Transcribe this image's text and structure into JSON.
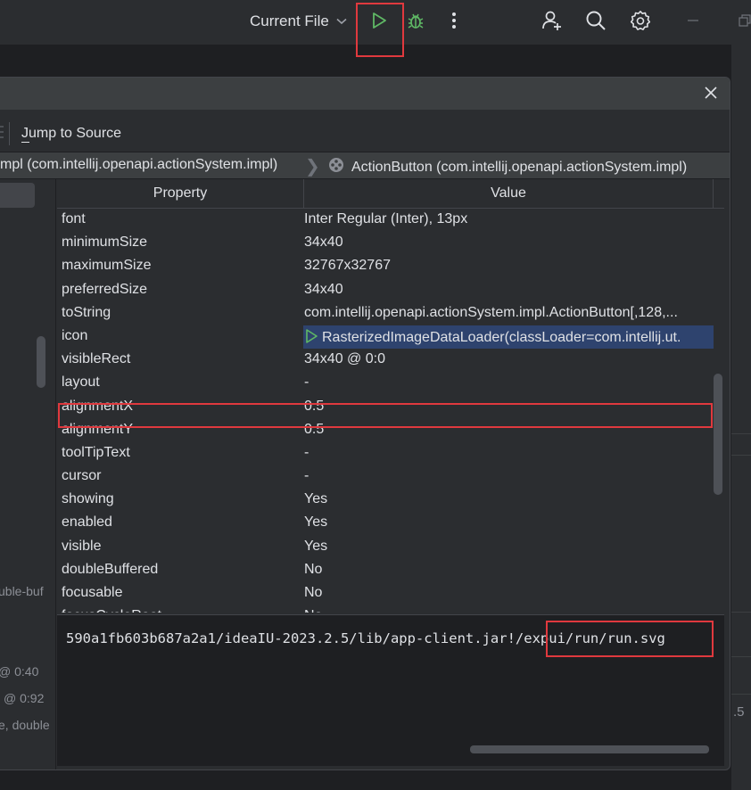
{
  "toolbar": {
    "run_config_label": "Current File",
    "icons": [
      "chevron-down-icon",
      "run-icon",
      "debug-icon",
      "more-icon",
      "add-user-icon",
      "search-icon",
      "settings-icon",
      "minimize-icon",
      "restore-icon"
    ]
  },
  "dialog": {
    "close_label": "×",
    "jump_to_source": "Jump to Source",
    "breadcrumb_left": "mpl (com.intellij.openapi.actionSystem.impl)",
    "breadcrumb_sep": "❯",
    "breadcrumb_right": "ActionButton (com.intellij.openapi.actionSystem.impl)"
  },
  "table": {
    "headers": [
      "Property",
      "Value"
    ],
    "rows": [
      {
        "key": "font",
        "value": "Inter Regular (Inter), 13px"
      },
      {
        "key": "minimumSize",
        "value": "34x40"
      },
      {
        "key": "maximumSize",
        "value": "32767x32767"
      },
      {
        "key": "preferredSize",
        "value": "34x40"
      },
      {
        "key": "toString",
        "value": "com.intellij.openapi.actionSystem.impl.ActionButton[,128,..."
      },
      {
        "key": "icon",
        "value": "RasterizedImageDataLoader(classLoader=com.intellij.ut."
      },
      {
        "key": "visibleRect",
        "value": "34x40 @ 0:0"
      },
      {
        "key": "layout",
        "value": "-"
      },
      {
        "key": "alignmentX",
        "value": "0.5"
      },
      {
        "key": "alignmentY",
        "value": "0.5"
      },
      {
        "key": "toolTipText",
        "value": "-"
      },
      {
        "key": "cursor",
        "value": "-"
      },
      {
        "key": "showing",
        "value": "Yes"
      },
      {
        "key": "enabled",
        "value": "Yes"
      },
      {
        "key": "visible",
        "value": "Yes"
      },
      {
        "key": "doubleBuffered",
        "value": "No"
      },
      {
        "key": "focusable",
        "value": "No"
      },
      {
        "key": "focusCycleRoot",
        "value": "No"
      }
    ]
  },
  "path": {
    "text": "590a1fb603b687a2a1/ideaIU-2023.2.5/lib/app-client.jar!/expui/run/run.svg"
  },
  "left_fragments": {
    "frag1": "uble-buf",
    "frag2": "@ 0:40",
    "frag3": "@ 0:92",
    "frag4": "e, double"
  },
  "right_fragments": {
    "frag1": ".5"
  },
  "colors": {
    "highlight": "#e0393e",
    "run_green": "#5fb865",
    "selection": "#2e436e"
  }
}
